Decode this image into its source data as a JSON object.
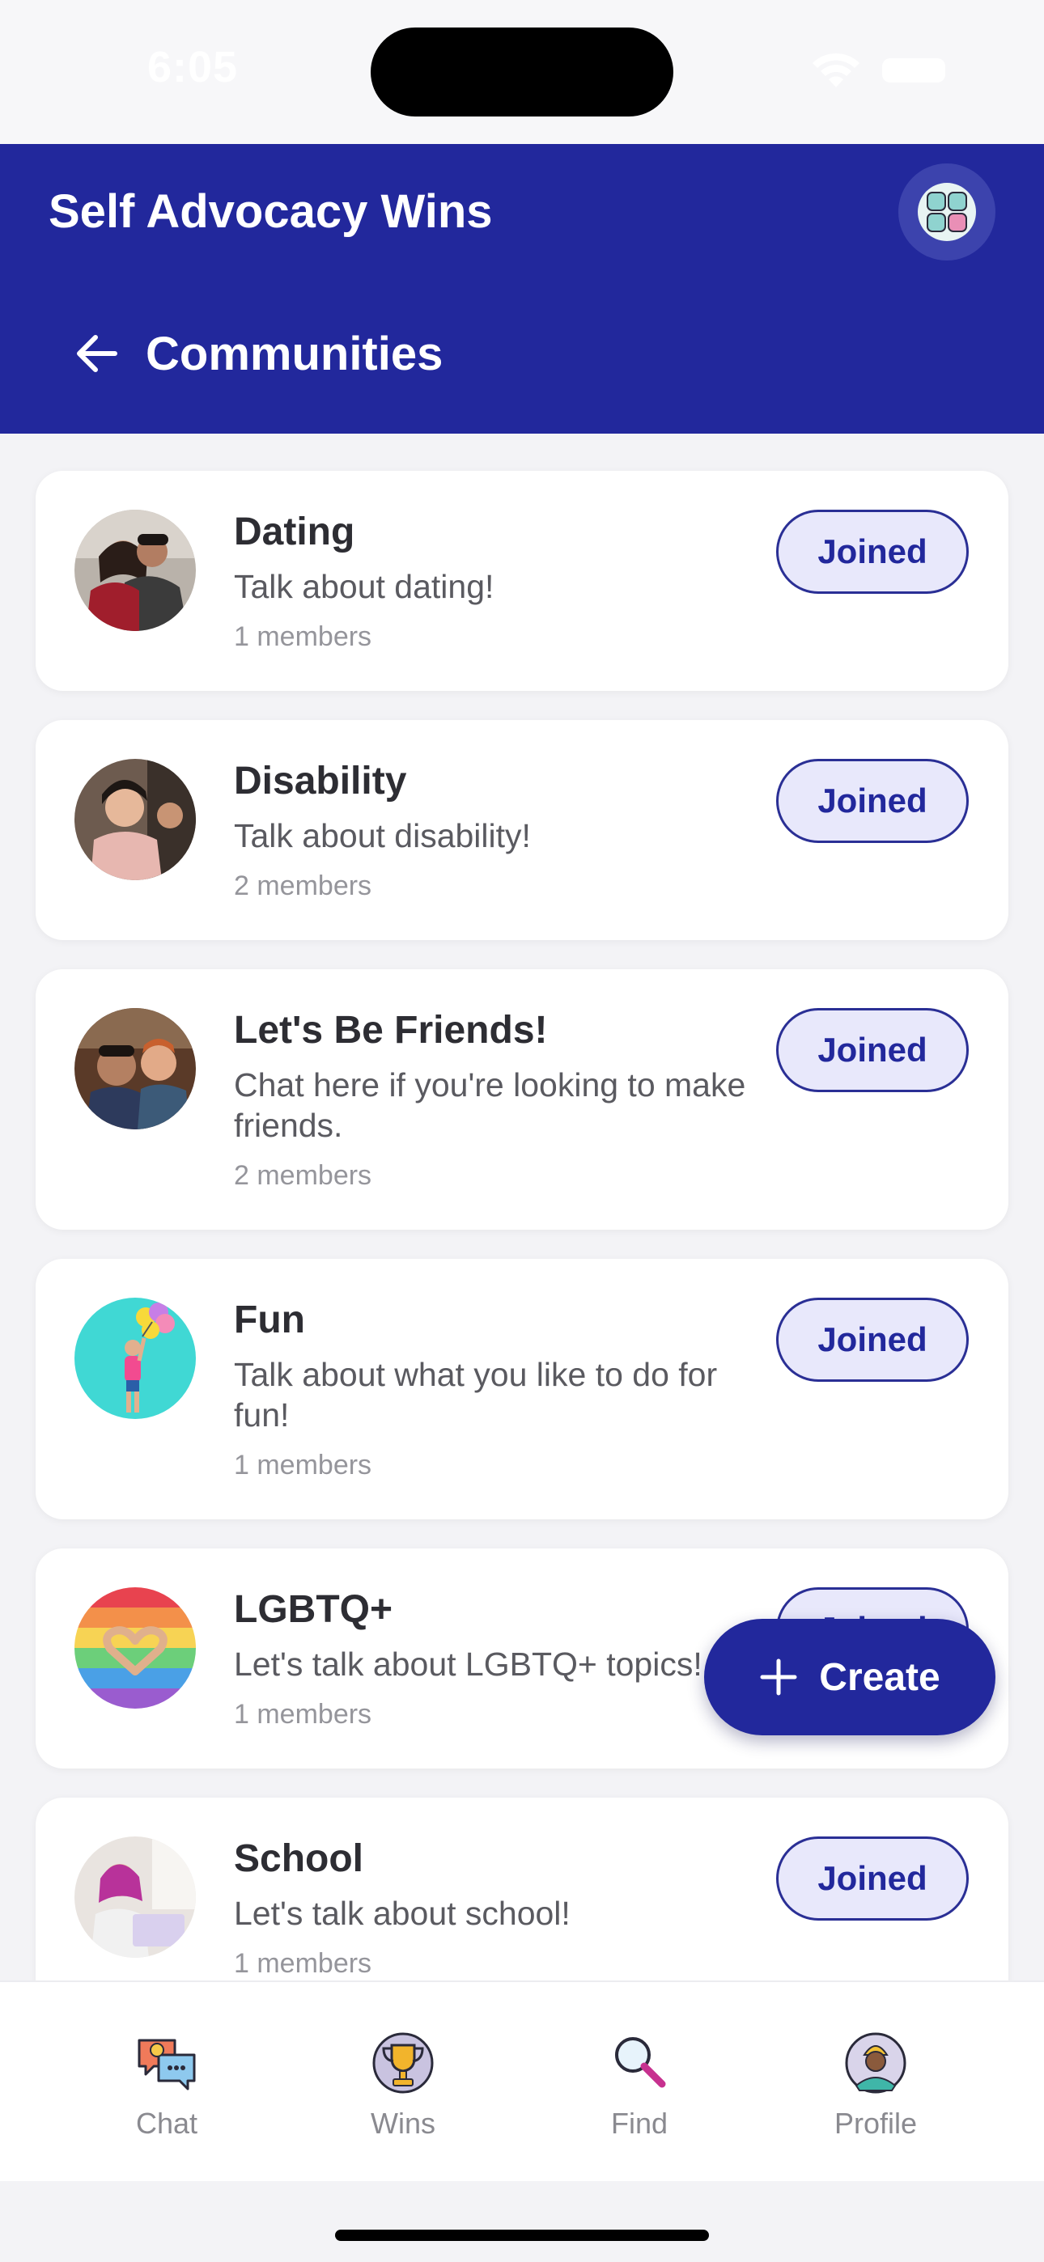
{
  "status": {
    "time": "6:05"
  },
  "header": {
    "app_title": "Self Advocacy Wins",
    "page_title": "Communities"
  },
  "communities": [
    {
      "name": "Dating",
      "description": "Talk about dating!",
      "members": "1 members",
      "button": "Joined"
    },
    {
      "name": "Disability",
      "description": "Talk about disability!",
      "members": "2 members",
      "button": "Joined"
    },
    {
      "name": "Let's Be Friends!",
      "description": "Chat here if you're looking to make friends.",
      "members": "2 members",
      "button": "Joined"
    },
    {
      "name": "Fun",
      "description": "Talk about what you like to do for fun!",
      "members": "1 members",
      "button": "Joined"
    },
    {
      "name": "LGBTQ+",
      "description": "Let's talk about LGBTQ+ topics!",
      "members": "1 members",
      "button": "Joined"
    },
    {
      "name": "School",
      "description": "Let's talk about school!",
      "members": "1 members",
      "button": "Joined"
    }
  ],
  "fab": {
    "label": "Create"
  },
  "tabs": [
    {
      "label": "Chat",
      "icon": "chat-icon"
    },
    {
      "label": "Wins",
      "icon": "trophy-icon"
    },
    {
      "label": "Find",
      "icon": "magnifier-icon"
    },
    {
      "label": "Profile",
      "icon": "profile-icon"
    }
  ],
  "colors": {
    "primary": "#22289c",
    "button_bg": "#e8e8fb",
    "background": "#f3f3f6"
  }
}
